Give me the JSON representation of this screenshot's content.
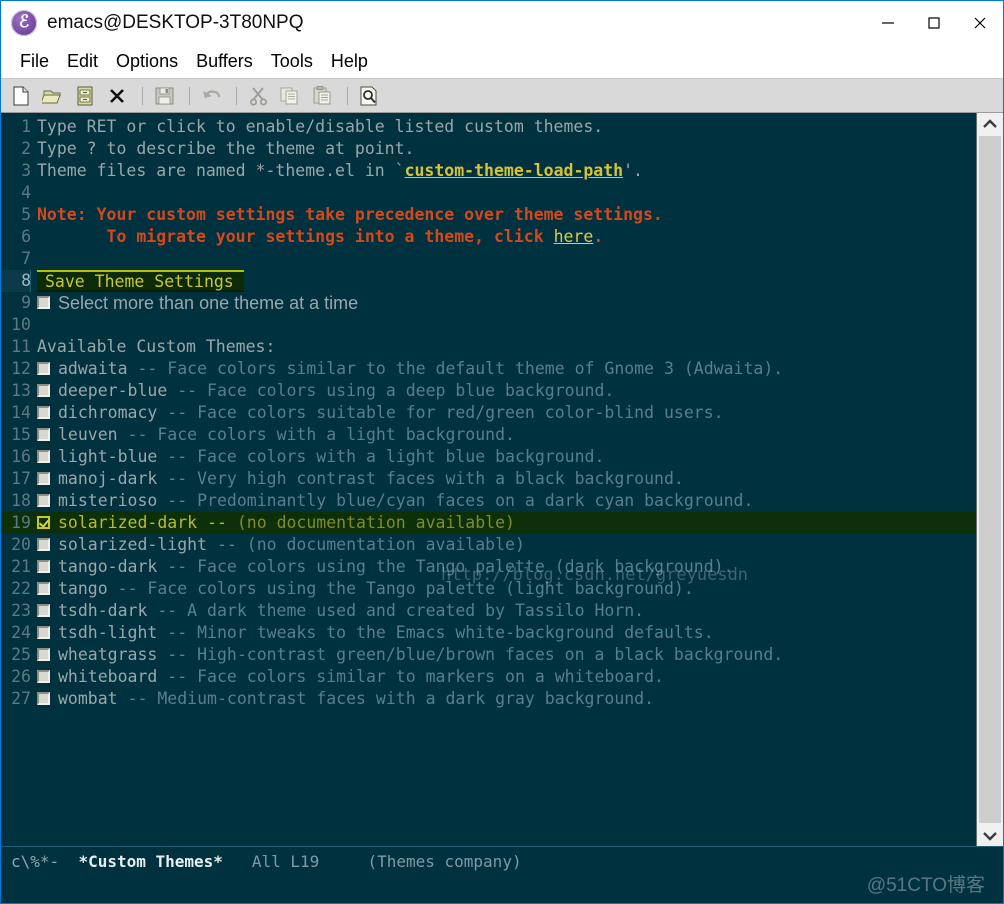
{
  "window": {
    "title": "emacs@DESKTOP-3T80NPQ",
    "icon": "emacs-icon",
    "minimize_label": "—",
    "maximize_label": "□",
    "close_label": "✕"
  },
  "menubar": {
    "items": [
      {
        "label": "File"
      },
      {
        "label": "Edit"
      },
      {
        "label": "Options"
      },
      {
        "label": "Buffers"
      },
      {
        "label": "Tools"
      },
      {
        "label": "Help"
      }
    ]
  },
  "toolbar": {
    "buttons": [
      {
        "name": "new-file-icon",
        "tooltip": "New File",
        "enabled": true
      },
      {
        "name": "open-folder-icon",
        "tooltip": "Open File",
        "enabled": true
      },
      {
        "name": "dired-icon",
        "tooltip": "Open Directory",
        "enabled": true
      },
      {
        "name": "close-buffer-icon",
        "tooltip": "Close Buffer",
        "enabled": true
      },
      {
        "name": "save-disk-icon",
        "tooltip": "Save Buffer",
        "enabled": false
      },
      {
        "name": "undo-icon",
        "tooltip": "Undo",
        "enabled": false
      },
      {
        "name": "cut-scissors-icon",
        "tooltip": "Cut",
        "enabled": false
      },
      {
        "name": "copy-icon",
        "tooltip": "Copy",
        "enabled": false
      },
      {
        "name": "paste-icon",
        "tooltip": "Paste",
        "enabled": false
      },
      {
        "name": "search-icon",
        "tooltip": "Search",
        "enabled": true
      }
    ]
  },
  "buffer": {
    "header_lines": [
      {
        "num": "1",
        "text": "Type RET or click to enable/disable listed custom themes."
      },
      {
        "num": "2",
        "text": "Type ? to describe the theme at point."
      },
      {
        "num": "3",
        "pre": "Theme files are named *-theme.el in `",
        "link": "custom-theme-load-path",
        "post": "'."
      },
      {
        "num": "4",
        "text": ""
      },
      {
        "num": "5",
        "note": "Note: Your custom settings take precedence over theme settings."
      },
      {
        "num": "6",
        "note_pre": "       To migrate your settings into a theme, click ",
        "note_link": "here",
        "note_post": "."
      },
      {
        "num": "7",
        "text": ""
      }
    ],
    "save_button": {
      "num": "8",
      "label": "Save Theme Settings"
    },
    "multi_select": {
      "num": "9",
      "label": "Select more than one theme at a time",
      "checked": false
    },
    "blank_line": {
      "num": "10"
    },
    "section_title": {
      "num": "11",
      "text": "Available Custom Themes:"
    },
    "themes": [
      {
        "num": "12",
        "name": "adwaita",
        "doc": "Face colors similar to the default theme of Gnome 3 (Adwaita).",
        "checked": false
      },
      {
        "num": "13",
        "name": "deeper-blue",
        "doc": "Face colors using a deep blue background.",
        "checked": false
      },
      {
        "num": "14",
        "name": "dichromacy",
        "doc": "Face colors suitable for red/green color-blind users.",
        "checked": false
      },
      {
        "num": "15",
        "name": "leuven",
        "doc": "Face colors with a light background.",
        "checked": false
      },
      {
        "num": "16",
        "name": "light-blue",
        "doc": "Face colors with a light blue background.",
        "checked": false
      },
      {
        "num": "17",
        "name": "manoj-dark",
        "doc": "Very high contrast faces with a black background.",
        "checked": false
      },
      {
        "num": "18",
        "name": "misterioso",
        "doc": "Predominantly blue/cyan faces on a dark cyan background.",
        "checked": false
      },
      {
        "num": "19",
        "name": "solarized-dark",
        "doc": "(no documentation available)",
        "checked": true
      },
      {
        "num": "20",
        "name": "solarized-light",
        "doc": "(no documentation available)",
        "checked": false
      },
      {
        "num": "21",
        "name": "tango-dark",
        "doc": "Face colors using the Tango palette (dark background).",
        "checked": false
      },
      {
        "num": "22",
        "name": "tango",
        "doc": "Face colors using the Tango palette (light background).",
        "checked": false
      },
      {
        "num": "23",
        "name": "tsdh-dark",
        "doc": "A dark theme used and created by Tassilo Horn.",
        "checked": false
      },
      {
        "num": "24",
        "name": "tsdh-light",
        "doc": "Minor tweaks to the Emacs white-background defaults.",
        "checked": false
      },
      {
        "num": "25",
        "name": "wheatgrass",
        "doc": "High-contrast green/blue/brown faces on a black background.",
        "checked": false
      },
      {
        "num": "26",
        "name": "whiteboard",
        "doc": "Face colors similar to markers on a whiteboard.",
        "checked": false
      },
      {
        "num": "27",
        "name": "wombat",
        "doc": "Medium-contrast faces with a dark gray background.",
        "checked": false
      }
    ],
    "separator": "--"
  },
  "modeline": {
    "flags": "c\\%*-",
    "buffer_name": "*Custom Themes*",
    "position": "All L19",
    "modes": "(Themes company)"
  },
  "scrollbar": {
    "up_arrow": "⌃",
    "down_arrow": "⌄"
  },
  "watermarks": {
    "middle": "http://blog.csdn.net/greyuesdn",
    "bottom_right": "@51CTO博客"
  },
  "colors": {
    "frame_bg": "#00313f",
    "accent_link": "#d6c436",
    "warning": "#d4481b",
    "selection_bg": "#0d3008",
    "selection_fg": "#b6bb2f",
    "titlebar_border": "#0078d7"
  }
}
